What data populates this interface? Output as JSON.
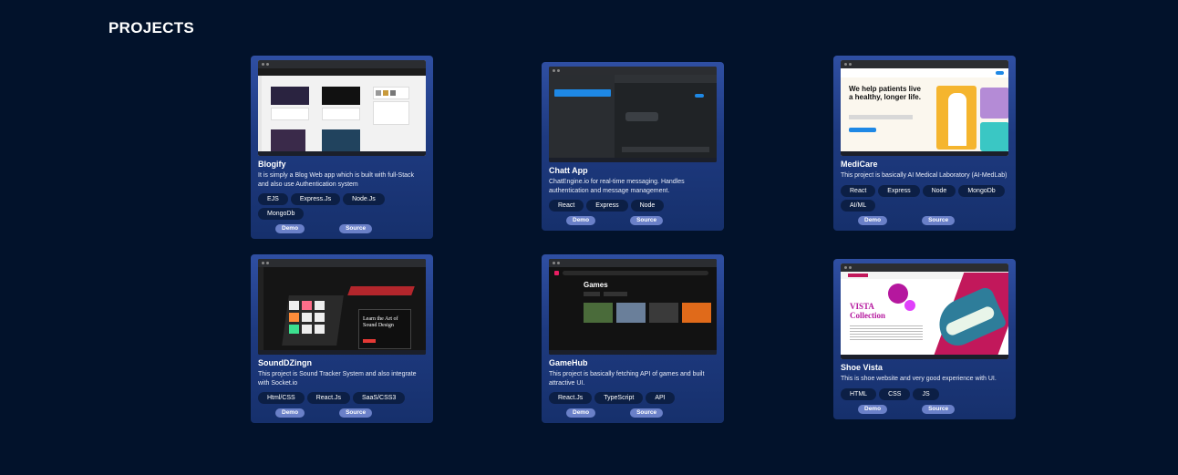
{
  "section": {
    "title": "PROJECTS"
  },
  "projects": [
    {
      "title": "Blogify",
      "description": "It is simply a Blog Web app which is built with full-Stack and also use Authentication system",
      "tags": [
        "EJS",
        "Express.Js",
        "Node.Js",
        "MongoDb"
      ],
      "demo_label": "Demo",
      "source_label": "Source"
    },
    {
      "title": "Chatt App",
      "description": "ChatEngine.io for real-time messaging. Handles authentication and message management.",
      "tags": [
        "React",
        "Express",
        "Node"
      ],
      "demo_label": "Demo",
      "source_label": "Source"
    },
    {
      "title": "MediCare",
      "description": "This project is basically AI Medical Laboratory (AI-MedLab)",
      "tags": [
        "React",
        "Express",
        "Node",
        "MongoDb",
        "AI/ML"
      ],
      "demo_label": "Demo",
      "source_label": "Source",
      "thumb_heading": "We help patients live a healthy, longer life."
    },
    {
      "title": "SoundDZingn",
      "description": "This project is Sound Tracker System and also integrate with Socket.io",
      "tags": [
        "Html/CSS",
        "React.Js",
        "SaaS/CSS3"
      ],
      "demo_label": "Demo",
      "source_label": "Source",
      "thumb_heading": "Learn the Art of Sound Design"
    },
    {
      "title": "GameHub",
      "description": "This project is basically fetching API of games and built attractive UI.",
      "tags": [
        "React.Js",
        "TypeScript",
        "API"
      ],
      "demo_label": "Demo",
      "source_label": "Source",
      "thumb_heading": "Games"
    },
    {
      "title": "Shoe Vista",
      "description": "This is shoe website and very good experience with UI.",
      "tags": [
        "HTML",
        "CSS",
        "JS"
      ],
      "demo_label": "Demo",
      "source_label": "Source",
      "thumb_heading": "VISTA Collection"
    }
  ],
  "colors": {
    "background": "#02122b",
    "card_top": "#2f4fa3",
    "card_bottom": "#16306c",
    "tag_bg": "#0c1f45",
    "button_bg": "#6a80c8"
  }
}
